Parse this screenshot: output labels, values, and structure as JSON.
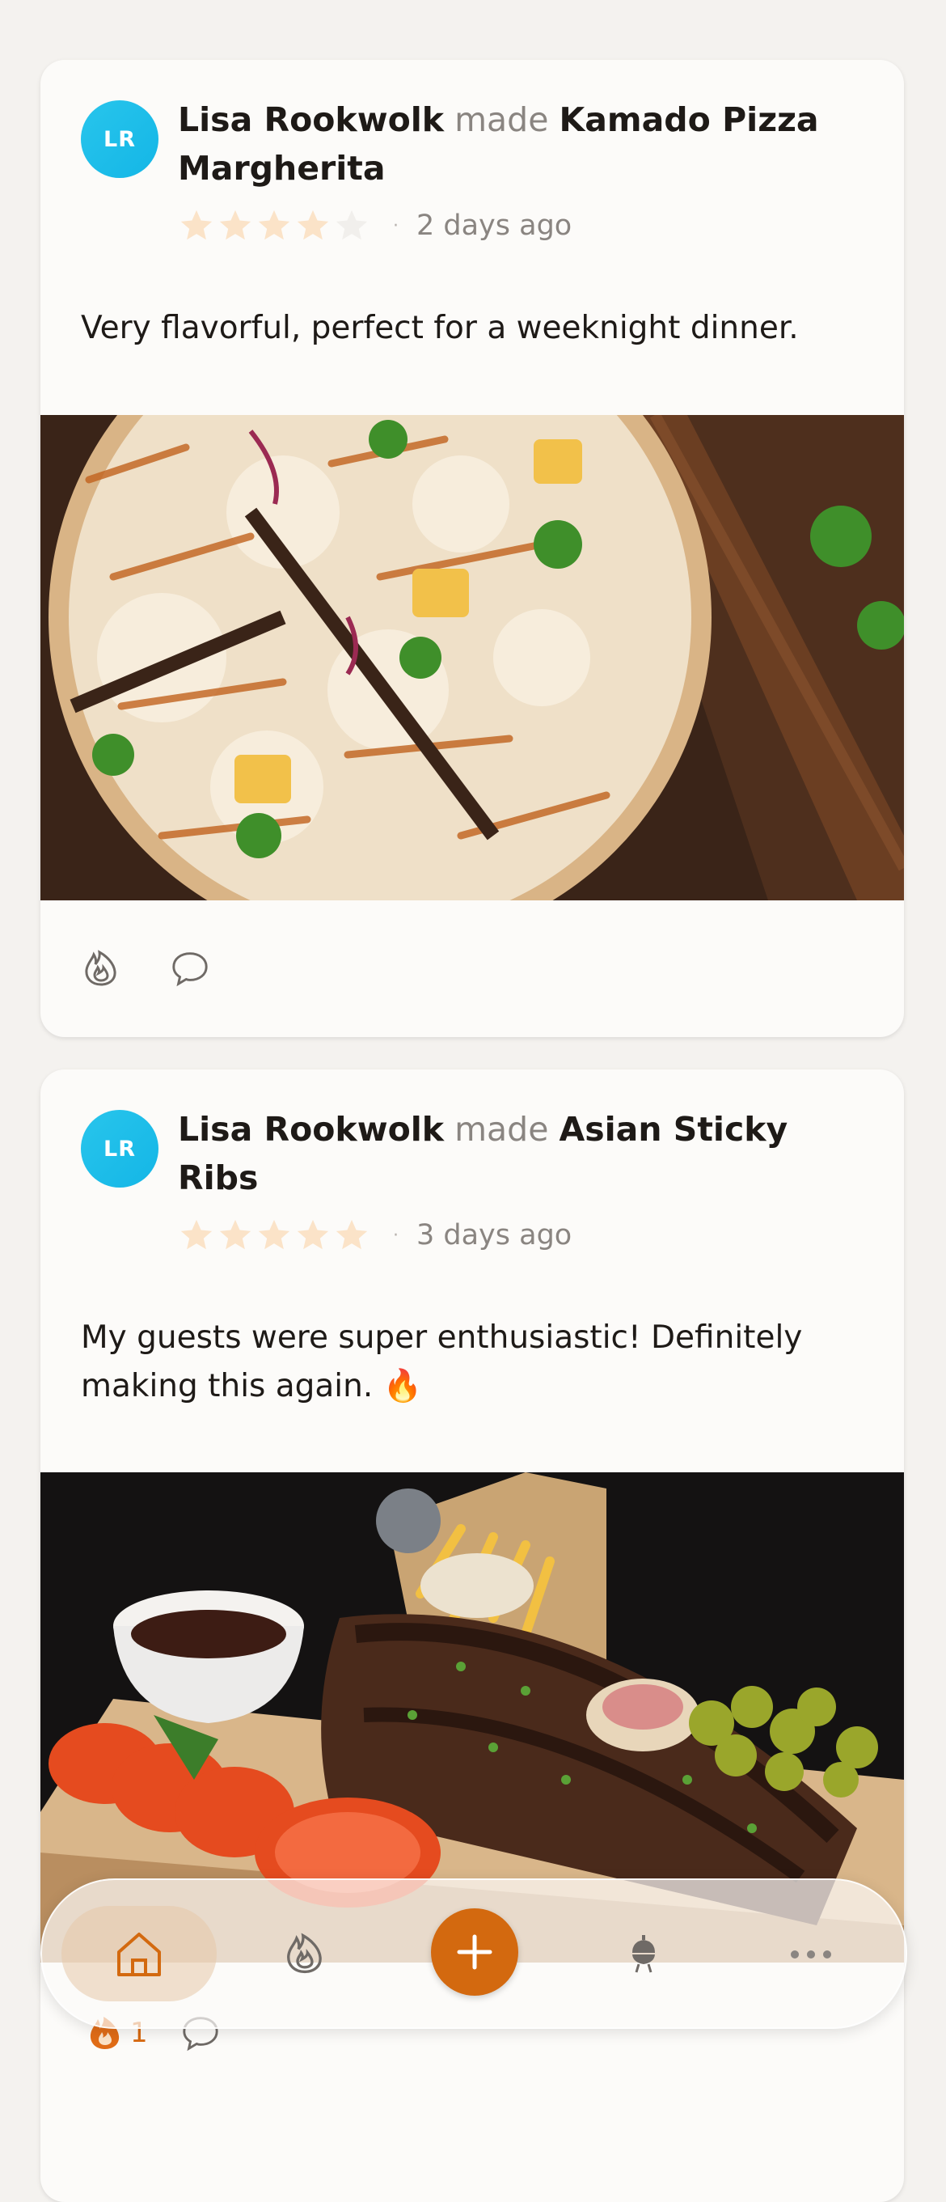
{
  "feed": [
    {
      "avatar_initials": "LR",
      "user_name": "Lisa Rookwolk",
      "verb": "made",
      "recipe": "Kamado Pizza Margherita",
      "rating": 4,
      "rating_max": 5,
      "separator": "·",
      "time_ago": "2 days ago",
      "comment": "Very flavorful, perfect for a weeknight dinner.",
      "photo_subject": "pizza",
      "likes_count": ""
    },
    {
      "avatar_initials": "LR",
      "user_name": "Lisa Rookwolk",
      "verb": "made",
      "recipe": "Asian Sticky Ribs",
      "rating": 5,
      "rating_max": 5,
      "separator": "·",
      "time_ago": "3 days ago",
      "comment": "My guests were super enthusiastic! Definitely making this again. 🔥",
      "photo_subject": "ribs",
      "likes_count": "1"
    }
  ],
  "nav": {
    "items": [
      "home-icon",
      "fire-icon",
      "plus-icon",
      "kamado-grill-icon",
      "more-icon"
    ],
    "active": "home-icon"
  },
  "colors": {
    "accent": "#d3690f",
    "avatar": "#1cbde9",
    "star_filled": "#fbe3c8",
    "star_empty": "#f1efec",
    "background": "#f4f2ef",
    "card": "#fcfbf9"
  }
}
